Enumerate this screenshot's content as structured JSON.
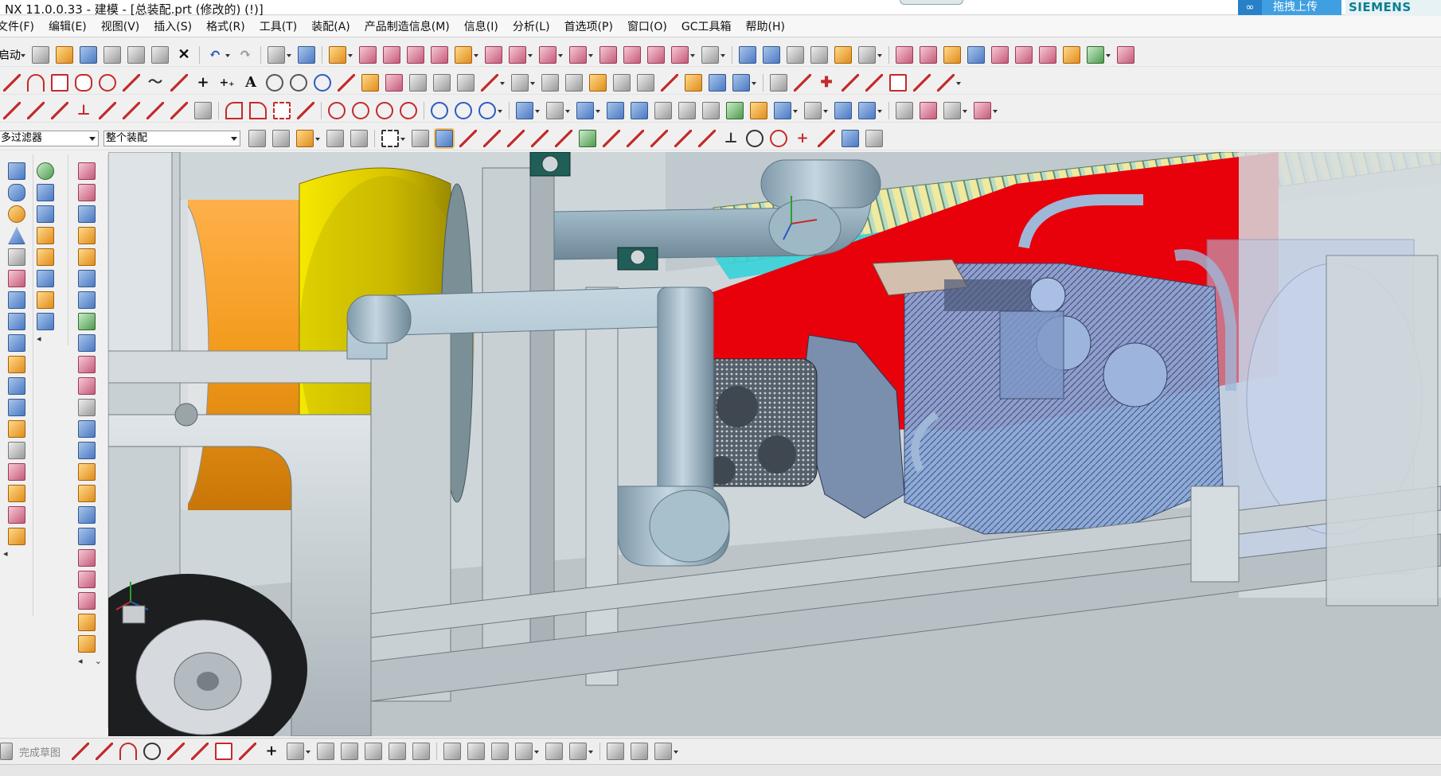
{
  "window": {
    "title": "NX 11.0.0.33 - 建模 - [总装配.prt  (修改的)    (!)]",
    "upload_label": "拖拽上传",
    "brand": "SIEMENS"
  },
  "menu": [
    {
      "label": "文件(F)"
    },
    {
      "label": "编辑(E)"
    },
    {
      "label": "视图(V)"
    },
    {
      "label": "插入(S)"
    },
    {
      "label": "格式(R)"
    },
    {
      "label": "工具(T)"
    },
    {
      "label": "装配(A)"
    },
    {
      "label": "产品制造信息(M)"
    },
    {
      "label": "信息(I)"
    },
    {
      "label": "分析(L)"
    },
    {
      "label": "首选项(P)"
    },
    {
      "label": "窗口(O)"
    },
    {
      "label": "GC工具箱"
    },
    {
      "label": "帮助(H)"
    }
  ],
  "toolbar": {
    "start_label": "启动",
    "selection_filter": "多过滤器",
    "assembly_scope": "整个装配"
  },
  "sketch_bar": {
    "finish_label": "完成草图"
  },
  "viewport": {
    "highlight_color": "#e8000b",
    "pipe_color": "#9fb8c6",
    "drum_color": "#e0c800",
    "motor_color": "#f29a1a",
    "engine_color": "#8aa8d8"
  },
  "colors": {
    "brand": "#0a7f93",
    "upload_bg": "#3f9fe0"
  }
}
